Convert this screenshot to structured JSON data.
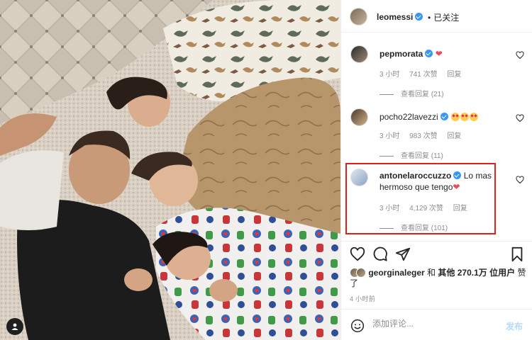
{
  "post": {
    "author": "leomessi",
    "follow_status": "已关注",
    "follow_dot": "•"
  },
  "comments": [
    {
      "username": "pepmorata",
      "text": "",
      "emoji": "heart",
      "time": "3 小时",
      "likes": "741 次赞",
      "reply": "回复",
      "view_replies": "查看回复 (21)"
    },
    {
      "username": "pocho22lavezzi",
      "text": "",
      "emoji": "heart-eyes x3",
      "time": "3 小时",
      "likes": "983 次赞",
      "reply": "回复",
      "view_replies": "查看回复 (11)"
    },
    {
      "username": "antonelaroccuzzo",
      "text": "Lo mas hermoso que tengo",
      "emoji": "heart",
      "time": "3 小时",
      "likes": "4,129 次赞",
      "reply": "回复",
      "view_replies": "查看回复 (101)"
    }
  ],
  "likes_line": {
    "user": "georginaleger",
    "connector": "和",
    "others": "其他 270.1万 位用户",
    "suffix": "赞了"
  },
  "time_ago": "4 小时前",
  "add_comment": {
    "placeholder": "添加评论...",
    "post_label": "发布"
  },
  "colors": {
    "verified": "#3897f0",
    "highlight_box": "#e0201a",
    "heart": "#ed4956",
    "post_disabled": "#b3dbff"
  },
  "icons": {
    "like": "heart-outline-icon",
    "comment": "comment-icon",
    "share": "paper-plane-icon",
    "save": "bookmark-icon",
    "emoji": "smiley-icon",
    "photo_user": "user-tag-icon"
  }
}
